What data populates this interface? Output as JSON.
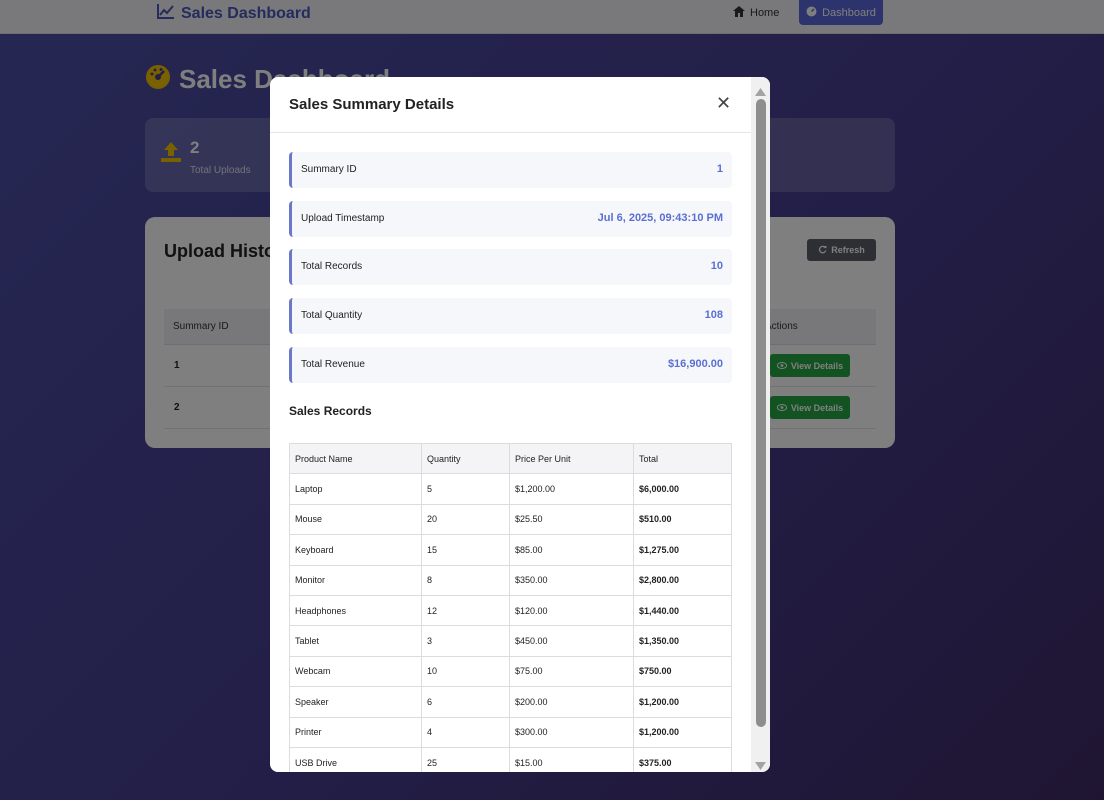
{
  "navbar": {
    "brand": "Sales Dashboard",
    "home_label": "Home",
    "dashboard_label": "Dashboard"
  },
  "page": {
    "title": "Sales Dashboard"
  },
  "stats": {
    "uploads_value": "2",
    "uploads_label": "Total Uploads"
  },
  "history": {
    "title": "Upload History",
    "refresh_label": "Refresh",
    "col_summary_id": "Summary ID",
    "col_actions": "Actions",
    "rows": [
      {
        "id": "1",
        "action": "View Details"
      },
      {
        "id": "2",
        "action": "View Details"
      }
    ]
  },
  "modal": {
    "title": "Sales Summary Details",
    "close_glyph": "✕",
    "info": [
      {
        "label": "Summary ID",
        "value": "1"
      },
      {
        "label": "Upload Timestamp",
        "value": "Jul 6, 2025, 09:43:10 PM"
      },
      {
        "label": "Total Records",
        "value": "10"
      },
      {
        "label": "Total Quantity",
        "value": "108"
      },
      {
        "label": "Total Revenue",
        "value": "$16,900.00"
      }
    ],
    "records_title": "Sales Records",
    "columns": [
      "Product Name",
      "Quantity",
      "Price Per Unit",
      "Total"
    ],
    "records": [
      [
        "Laptop",
        "5",
        "$1,200.00",
        "$6,000.00"
      ],
      [
        "Mouse",
        "20",
        "$25.50",
        "$510.00"
      ],
      [
        "Keyboard",
        "15",
        "$85.00",
        "$1,275.00"
      ],
      [
        "Monitor",
        "8",
        "$350.00",
        "$2,800.00"
      ],
      [
        "Headphones",
        "12",
        "$120.00",
        "$1,440.00"
      ],
      [
        "Tablet",
        "3",
        "$450.00",
        "$1,350.00"
      ],
      [
        "Webcam",
        "10",
        "$75.00",
        "$750.00"
      ],
      [
        "Speaker",
        "6",
        "$200.00",
        "$1,200.00"
      ],
      [
        "Printer",
        "4",
        "$300.00",
        "$1,200.00"
      ],
      [
        "USB Drive",
        "25",
        "$15.00",
        "$375.00"
      ]
    ]
  },
  "colors": {
    "accent": "#5a67d8",
    "success": "#27a745",
    "info_value": "#5a6fd0",
    "upload_icon": "#f2c200"
  },
  "icons": {
    "brand": "chart-line-icon",
    "home": "home-icon",
    "dashboard": "gauge-icon",
    "page_title": "speedometer-icon",
    "uploads": "upload-icon",
    "refresh": "refresh-icon",
    "view": "eye-icon",
    "close": "close-icon"
  }
}
